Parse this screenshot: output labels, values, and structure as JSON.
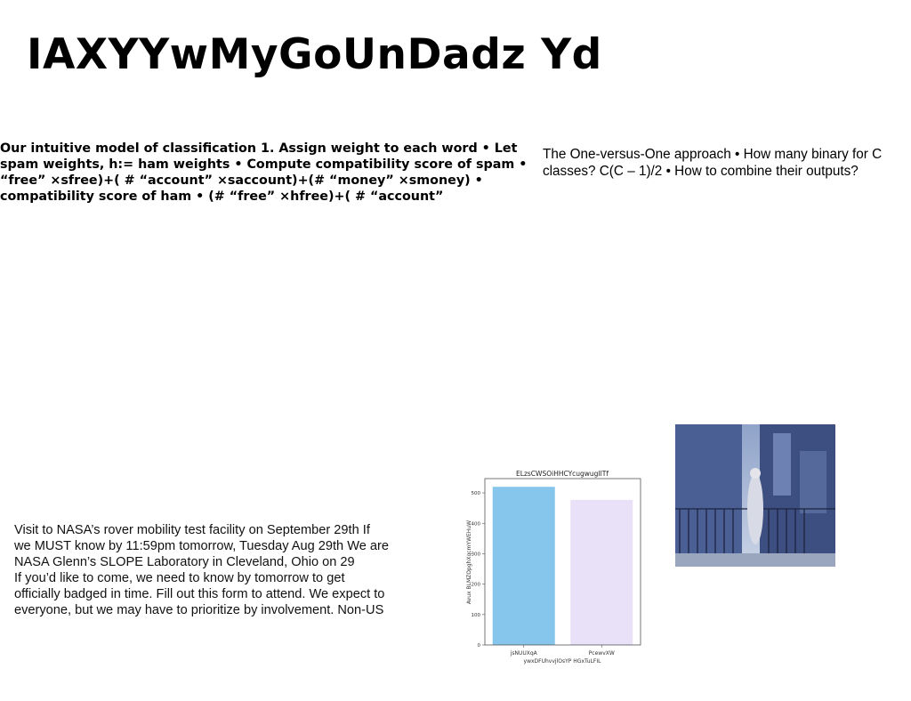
{
  "title": "IAXYYwMyGoUnDadz Yd",
  "left_text": "Our intuitive model of classification 1. Assign weight to each word • Let spam weights, h:= ham weights • Compute compatibility score of spam • “free” ×sfree)+( # “account” ×saccount)+(# “money” ×smoney) • compatibility score of ham • (# “free” ×hfree)+( # “account”",
  "right_text": "The One-versus-One approach • How many binary for C classes? C(C – 1)/2 • How to combine their outputs?",
  "nasa_text": "Visit to NASA’s rover mobility test facility on September 29th If\nwe MUST know by 11:59pm tomorrow, Tuesday Aug 29th We are\nNASA Glenn’s SLOPE Laboratory in Cleveland, Ohio on 29\nIf you’d like to come, we need to know by tomorrow to get\nofficially badged in time. Fill out this form to attend. We expect to\neveryone, but we may have to prioritize by involvement. Non-US",
  "chart_data": {
    "type": "bar",
    "title": "ELzsCWSOiHHCYcugwugIlTf",
    "xlabel": "ywxDFUhvvjlOsYP HGxTuLFIL",
    "ylabel": "Avux BLMZOpghXqcmYWEHuW",
    "categories": [
      "jsNUUXqA",
      "PcewvXW"
    ],
    "values": [
      520,
      477
    ],
    "colors": [
      "#86c5ec",
      "#e8e1f7"
    ],
    "yticks": [
      0,
      100,
      200,
      300,
      400,
      500
    ],
    "ylim": [
      0,
      547
    ],
    "grid": false
  },
  "photo": {
    "description_icon": "street-photo"
  }
}
